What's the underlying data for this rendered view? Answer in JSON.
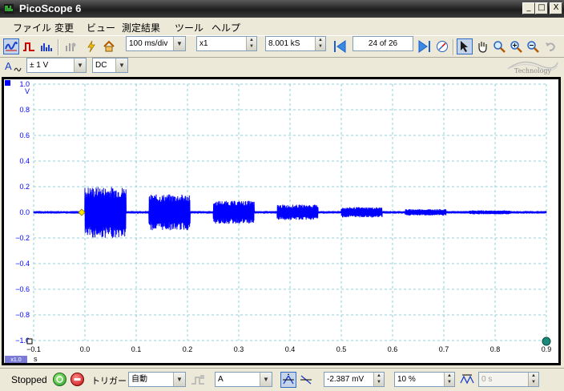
{
  "window": {
    "title": "PicoScope 6",
    "controls": [
      "_",
      "□",
      "X"
    ]
  },
  "menu": {
    "items": [
      "ファイル",
      "変更",
      "ビュー",
      "測定結果",
      "ツール",
      "ヘルプ"
    ]
  },
  "toolbar": {
    "timebase": "100 ms/div",
    "zoom": "x1",
    "samples": "8.001 kS",
    "buffer": "24 of 26"
  },
  "channel": {
    "name": "A",
    "range": "± 1 V",
    "coupling": "DC"
  },
  "logo": {
    "text": "Technology"
  },
  "scope": {
    "y_unit": "V",
    "x_unit": "s",
    "x_scale_badge": "x1.0",
    "y_ticks": [
      "1.0",
      "0.8",
      "0.6",
      "0.4",
      "0.2",
      "0.0",
      "−0.2",
      "−0.4",
      "−0.6",
      "−0.8",
      "−1.0"
    ],
    "x_ticks": [
      "−0.1",
      "0.0",
      "0.1",
      "0.2",
      "0.3",
      "0.4",
      "0.5",
      "0.6",
      "0.7",
      "0.8",
      "0.9"
    ],
    "trace_color": "#0000ff",
    "grid_color": "#8fd0d8"
  },
  "chart_data": {
    "type": "line",
    "xlabel": "s",
    "ylabel": "V",
    "xlim": [
      -0.1,
      0.9
    ],
    "ylim": [
      -1.0,
      1.0
    ],
    "grid": true,
    "series": [
      {
        "bursts": [
          {
            "start": 0.0,
            "end": 0.08,
            "amplitude": 0.2
          },
          {
            "start": 0.125,
            "end": 0.205,
            "amplitude": 0.14
          },
          {
            "start": 0.25,
            "end": 0.33,
            "amplitude": 0.09
          },
          {
            "start": 0.375,
            "end": 0.455,
            "amplitude": 0.06
          },
          {
            "start": 0.5,
            "end": 0.58,
            "amplitude": 0.04
          },
          {
            "start": 0.625,
            "end": 0.705,
            "amplitude": 0.025
          },
          {
            "start": 0.75,
            "end": 0.83,
            "amplitude": 0.015
          }
        ],
        "noise_amplitude": 0.01
      }
    ]
  },
  "status": {
    "run_state": "Stopped",
    "trigger_label": "トリガー",
    "trigger_mode": "自動",
    "trigger_channel": "A",
    "threshold": "-2.387 mV",
    "pre_trigger": "10 %",
    "delay": "0 s"
  }
}
